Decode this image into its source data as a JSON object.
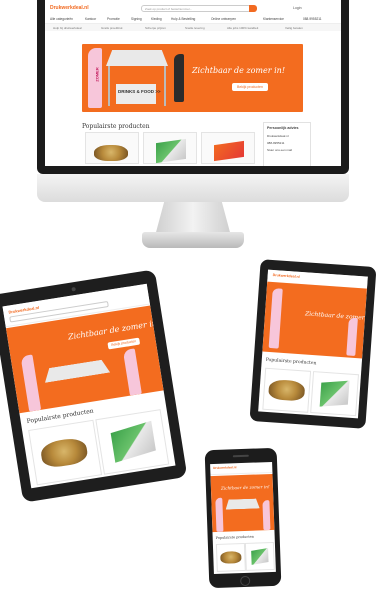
{
  "colors": {
    "brand_orange": "#f36c1f",
    "device_black": "#1e1e1e",
    "background": "#ffffff"
  },
  "desktop": {
    "logo_text": "Drukwerkdeal.nl",
    "search_placeholder": "Zoek op product of bestelnummer...",
    "login_label": "Login",
    "nav_items": [
      "Alle categorieën",
      "Kantoor",
      "Promotie",
      "Signing",
      "Kleding",
      "Hulp & Bestelling",
      "Online ontwerpen"
    ],
    "account_label": "Klantenservice",
    "phone_number": "088-9955211",
    "usp_items": [
      "Hulp bij drukwerkdeal",
      "Gratis proefdruk",
      "Scherpe prijzen",
      "Snelle levering",
      "Alle jobs 100% kwaliteit",
      "Veilig betalen"
    ],
    "hero_title": "Zichtbaar de zomer in!",
    "hero_button": "Bekijk producten",
    "section_title": "Populairste producten",
    "side_title": "Persoonlijk advies",
    "side_lines": [
      "Drukwerkdeal.nl",
      "088-9955211",
      "Stuur ons een mail"
    ],
    "hero_flag_text": "ZOMER",
    "hero_banner_text": "DRINKS & FOOD >>"
  },
  "tablet_landscape": {
    "logo_text": "Drukwerkdeal.nl",
    "hero_title": "Zichtbaar de zomer in!",
    "hero_button": "Bekijk producten",
    "section_title": "Populairste producten"
  },
  "tablet_portrait": {
    "logo_text": "Drukwerkdeal.nl",
    "hero_title": "Zichtbaar de zomer in!",
    "section_title": "Populairste producten"
  },
  "phone": {
    "logo_text": "Drukwerkdeal.nl",
    "hero_title": "Zichtbaar de zomer in!",
    "section_title": "Populairste producten"
  }
}
